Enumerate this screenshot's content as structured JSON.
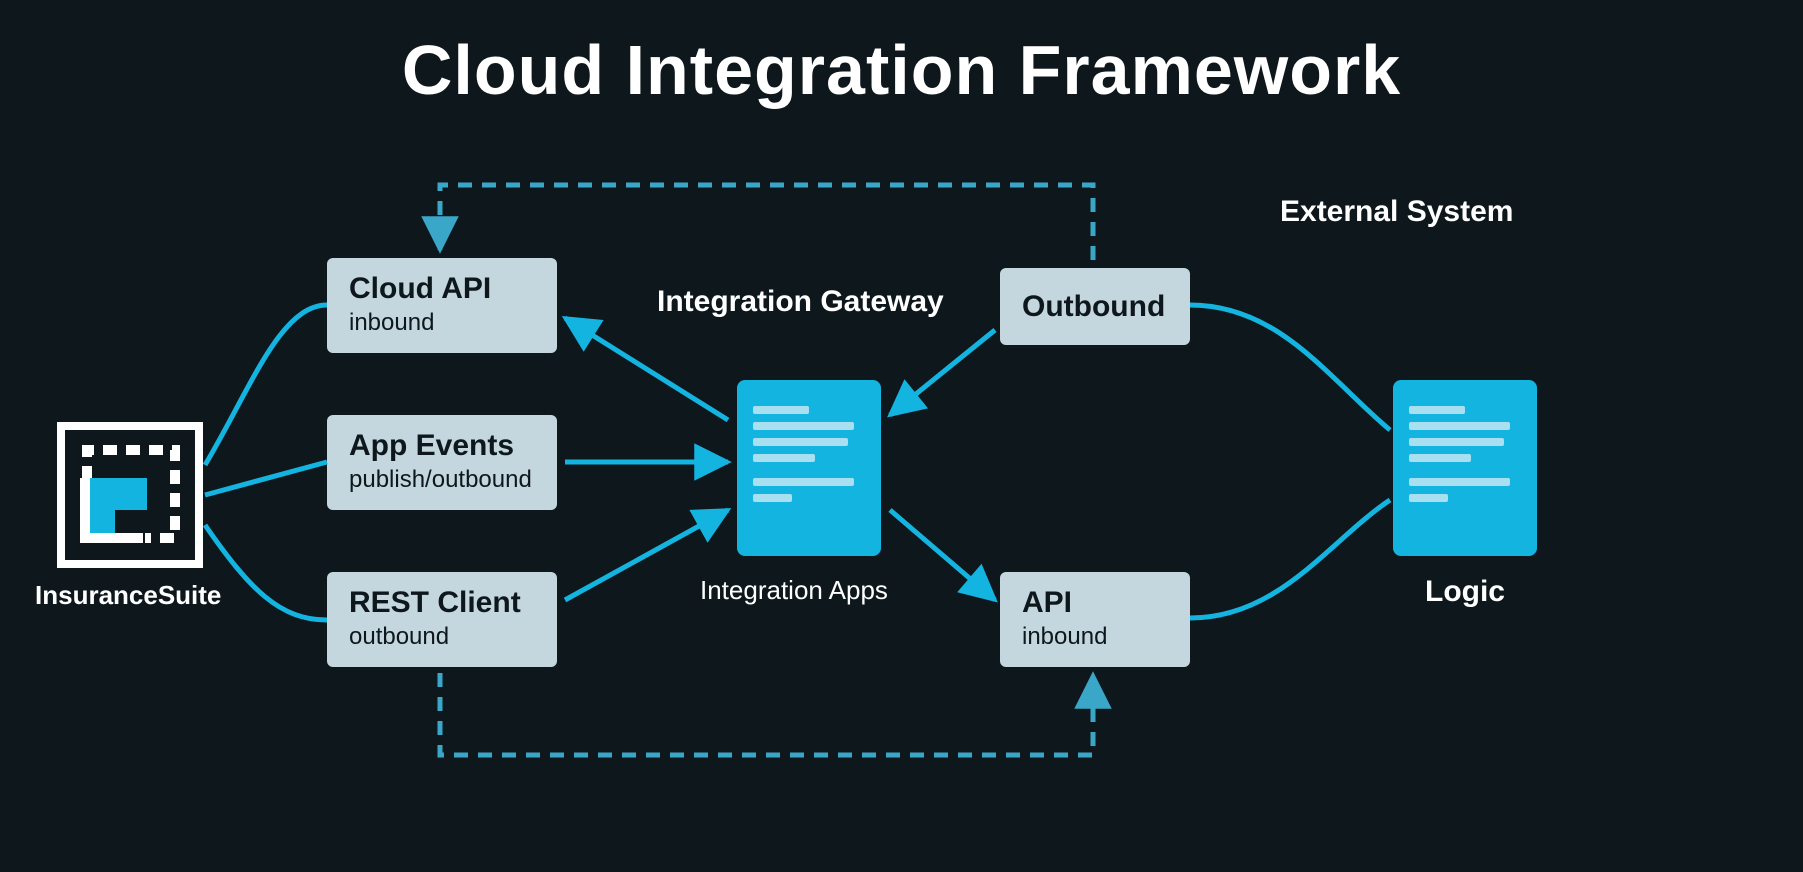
{
  "title": "Cloud Integration Framework",
  "left": {
    "icon_label": "InsuranceSuite",
    "boxes": [
      {
        "title": "Cloud API",
        "sub": "inbound"
      },
      {
        "title": "App Events",
        "sub": "publish/outbound"
      },
      {
        "title": "REST Client",
        "sub": "outbound"
      }
    ]
  },
  "center": {
    "heading": "Integration Gateway",
    "icon_label": "Integration Apps"
  },
  "right": {
    "heading": "External System",
    "boxes": [
      {
        "title": "Outbound",
        "sub": ""
      },
      {
        "title": "API",
        "sub": "inbound"
      }
    ],
    "icon_label": "Logic"
  },
  "colors": {
    "accent": "#14b4e1",
    "box": "#c4d7de",
    "bg": "#0e171c"
  }
}
